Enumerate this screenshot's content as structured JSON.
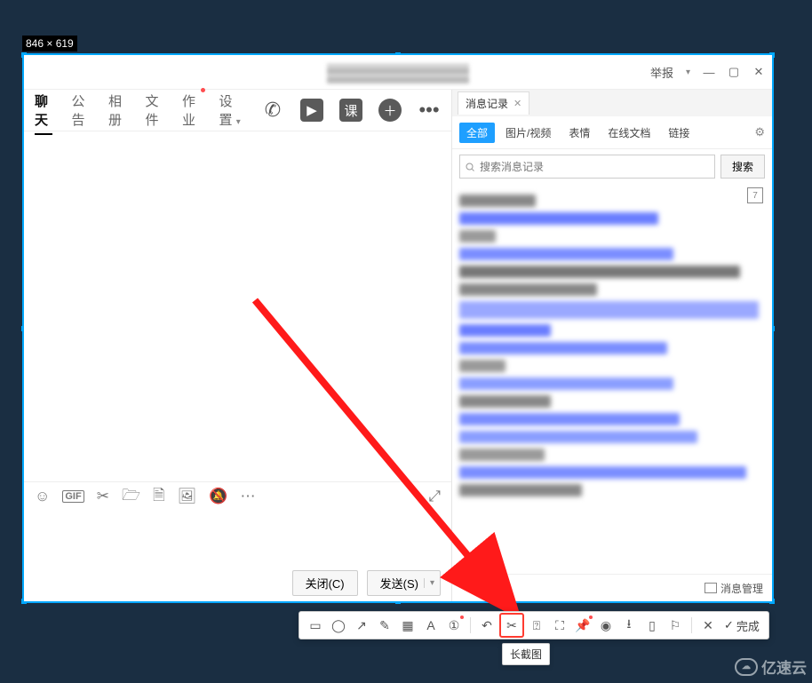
{
  "selection_size": "846 × 619",
  "titlebar": {
    "report": "举报"
  },
  "tabs": {
    "chat": "聊天",
    "notice": "公告",
    "album": "相册",
    "file": "文件",
    "homework": "作业",
    "settings": "设置",
    "class_label": "课"
  },
  "buttons": {
    "close": "关闭(C)",
    "send": "发送(S)"
  },
  "record_panel": {
    "tab_label": "消息记录",
    "filters": {
      "all": "全部",
      "media": "图片/视频",
      "emoji": "表情",
      "doc": "在线文档",
      "link": "链接"
    },
    "search_placeholder": "搜索消息记录",
    "search_btn": "搜索",
    "date_badge": "7",
    "manage": "消息管理"
  },
  "shot": {
    "done": "完成",
    "tooltip": "长截图"
  },
  "watermark": "亿速云"
}
